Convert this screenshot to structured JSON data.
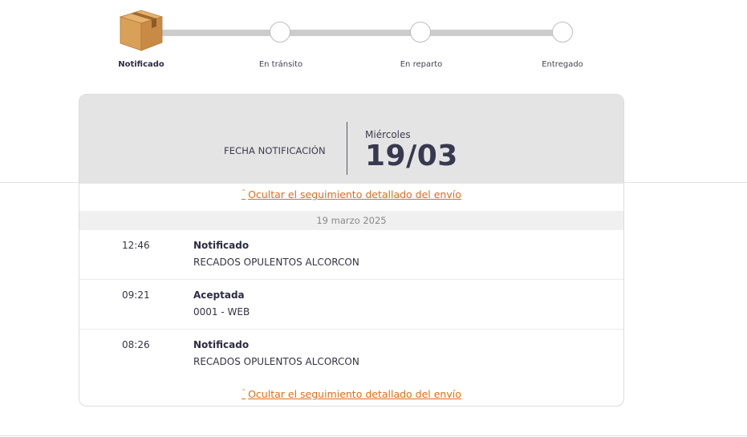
{
  "tracker": {
    "steps": [
      {
        "label": "Notificado",
        "active": true
      },
      {
        "label": "En tránsito",
        "active": false
      },
      {
        "label": "En reparto",
        "active": false
      },
      {
        "label": "Entregado",
        "active": false
      }
    ],
    "current_icon": "package-box-icon"
  },
  "card": {
    "notification_label": "FECHA NOTIFICACIÓN",
    "weekday": "Miércoles",
    "date": "19/03",
    "toggle_link": "Ocultar el seguimiento detallado del envío",
    "toggle_icon": "chevron-up-icon",
    "date_band": "19 marzo 2025",
    "events": [
      {
        "time": "12:46",
        "status": "Notificado",
        "place": "RECADOS OPULENTOS ALCORCON"
      },
      {
        "time": "09:21",
        "status": "Aceptada",
        "place": "0001 - WEB"
      },
      {
        "time": "08:26",
        "status": "Notificado",
        "place": "RECADOS OPULENTOS ALCORCON"
      }
    ]
  },
  "colors": {
    "accent": "#e36a1a",
    "header_bg": "#e4e4e4",
    "track": "#cccccc",
    "text_dark": "#2c2c44"
  }
}
